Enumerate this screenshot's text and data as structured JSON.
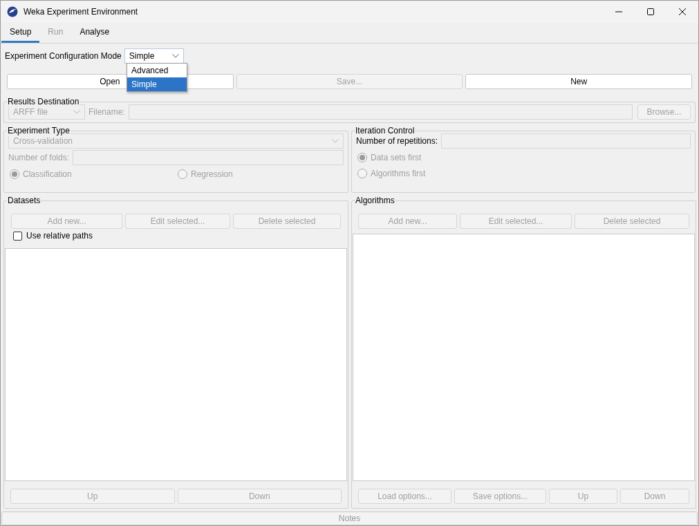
{
  "window": {
    "title": "Weka Experiment Environment"
  },
  "tabs": [
    {
      "label": "Setup",
      "selected": true,
      "disabled": false
    },
    {
      "label": "Run",
      "selected": false,
      "disabled": true
    },
    {
      "label": "Analyse",
      "selected": false,
      "disabled": false
    }
  ],
  "configuration_mode": {
    "label": "Experiment Configuration Mode",
    "value": "Simple",
    "options": [
      {
        "label": "Advanced",
        "selected": false
      },
      {
        "label": "Simple",
        "selected": true
      }
    ]
  },
  "file_buttons": [
    {
      "label": "Open",
      "disabled": false
    },
    {
      "label": "Save...",
      "disabled": true
    },
    {
      "label": "New",
      "disabled": false
    }
  ],
  "results_destination": {
    "title": "Results Destination",
    "type": "ARFF file",
    "filename_label": "Filename:",
    "browse": "Browse...",
    "disabled": true
  },
  "experiment_type": {
    "title": "Experiment Type",
    "type": "Cross-validation",
    "folds_label": "Number of folds:",
    "disabled": true,
    "options": [
      {
        "label": "Classification",
        "selected": true
      },
      {
        "label": "Regression",
        "selected": false
      }
    ]
  },
  "iteration_control": {
    "title": "Iteration Control",
    "repetitions_label": "Number of repetitions:",
    "disabled": true,
    "options": [
      {
        "label": "Data sets first",
        "selected": true
      },
      {
        "label": "Algorithms first",
        "selected": false
      }
    ]
  },
  "datasets": {
    "title": "Datasets",
    "buttons": [
      {
        "label": "Add new...",
        "disabled": true
      },
      {
        "label": "Edit selected...",
        "disabled": true
      },
      {
        "label": "Delete selected",
        "disabled": true
      }
    ],
    "relative_paths": {
      "label": "Use relative paths",
      "checked": false
    },
    "bottom_buttons": [
      {
        "label": "Up",
        "disabled": true
      },
      {
        "label": "Down",
        "disabled": true
      }
    ]
  },
  "algorithms": {
    "title": "Algorithms",
    "buttons": [
      {
        "label": "Add new...",
        "disabled": true
      },
      {
        "label": "Edit selected...",
        "disabled": true
      },
      {
        "label": "Delete selected",
        "disabled": true
      }
    ],
    "bottom_buttons": [
      {
        "label": "Load options...",
        "disabled": true
      },
      {
        "label": "Save options...",
        "disabled": true
      },
      {
        "label": "Up",
        "disabled": true
      },
      {
        "label": "Down",
        "disabled": true
      }
    ]
  },
  "notes": {
    "label": "Notes",
    "disabled": true
  }
}
